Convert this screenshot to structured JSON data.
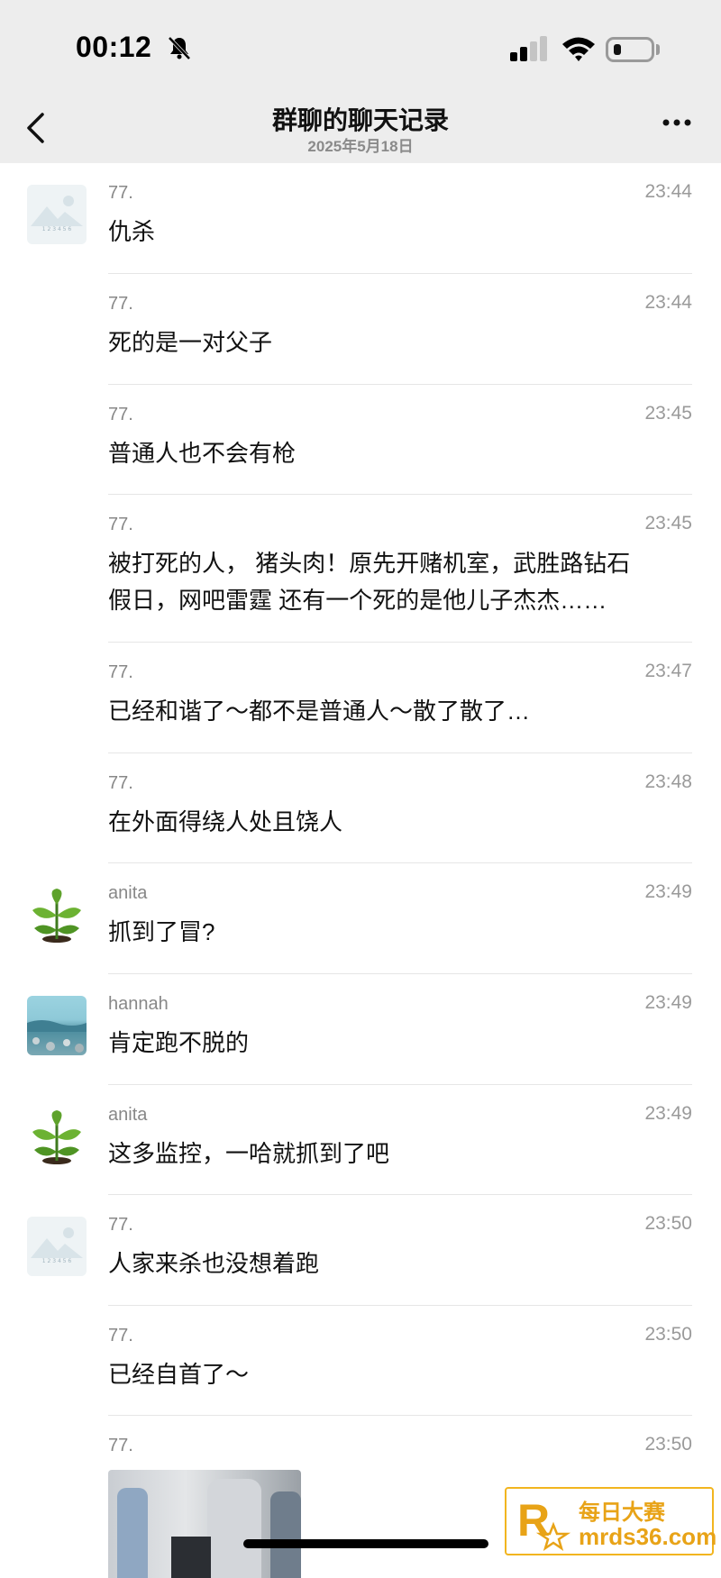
{
  "status_bar": {
    "time": "00:12"
  },
  "header": {
    "title": "群聊的聊天记录",
    "subtitle": "2025年5月18日"
  },
  "messages": [
    {
      "sender": "77.",
      "time": "23:44",
      "text": "仇杀",
      "avatar": "77"
    },
    {
      "sender": "77.",
      "time": "23:44",
      "text": "死的是一对父子"
    },
    {
      "sender": "77.",
      "time": "23:45",
      "text": "普通人也不会有枪"
    },
    {
      "sender": "77.",
      "time": "23:45",
      "text": "被打死的人， 猪头肉！原先开赌机室，武胜路钻石假日，网吧雷霆 还有一个死的是他儿子杰杰……"
    },
    {
      "sender": "77.",
      "time": "23:47",
      "text": "已经和谐了～都不是普通人～散了散了…"
    },
    {
      "sender": "77.",
      "time": "23:48",
      "text": "在外面得绕人处且饶人"
    },
    {
      "sender": "anita",
      "time": "23:49",
      "text": "抓到了冒?",
      "avatar": "plant"
    },
    {
      "sender": "hannah",
      "time": "23:49",
      "text": "肯定跑不脱的",
      "avatar": "sea"
    },
    {
      "sender": "anita",
      "time": "23:49",
      "text": "这多监控，一哈就抓到了吧",
      "avatar": "plant"
    },
    {
      "sender": "77.",
      "time": "23:50",
      "text": "人家来杀也没想着跑",
      "avatar": "77"
    },
    {
      "sender": "77.",
      "time": "23:50",
      "text": "已经自首了～"
    },
    {
      "sender": "77.",
      "time": "23:50",
      "text": ""
    }
  ],
  "avatar_caption": "1 2 3 4 5 6",
  "watermark": {
    "name": "每日大赛",
    "url": "mrds36.com",
    "logo_letter": "R"
  },
  "colors": {
    "header_bg": "#ededed",
    "accent": "#e8a317"
  }
}
